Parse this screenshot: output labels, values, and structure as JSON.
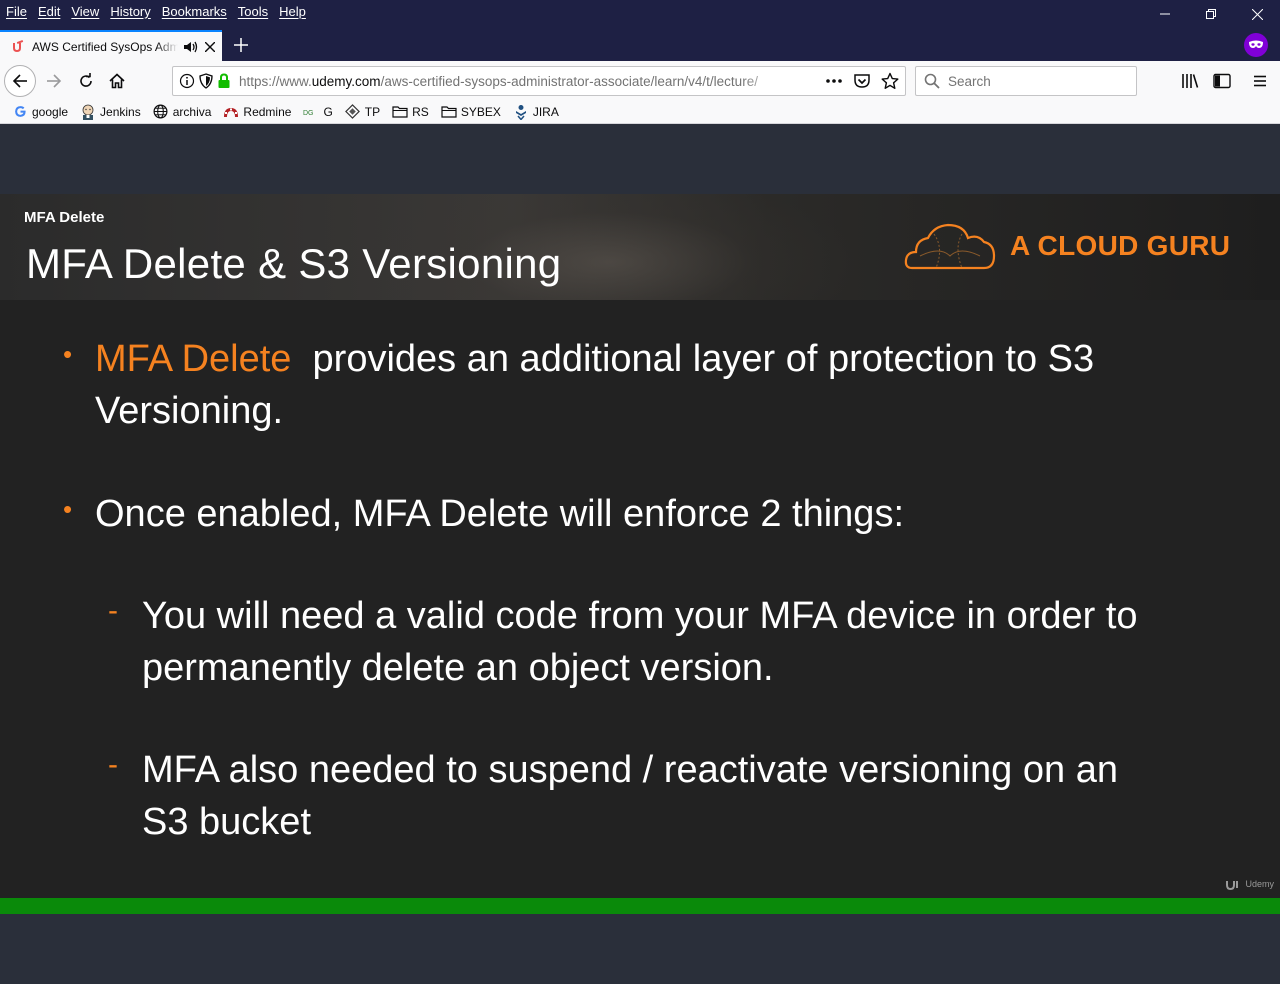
{
  "menubar": {
    "items": [
      "File",
      "Edit",
      "View",
      "History",
      "Bookmarks",
      "Tools",
      "Help"
    ]
  },
  "tab": {
    "title": "AWS Certified SysOps Administrator - Associate | Udemy",
    "favicon": "udemy-icon"
  },
  "navbar": {
    "url_prefix": "https://www.",
    "url_domain": "udemy.com",
    "url_path": "/aws-certified-sysops-administrator-associate/learn/v4/t/lecture/",
    "search_placeholder": "Search"
  },
  "bookmarks": [
    {
      "label": "google",
      "icon": "google-icon"
    },
    {
      "label": "Jenkins",
      "icon": "jenkins-icon"
    },
    {
      "label": "archiva",
      "icon": "globe-icon"
    },
    {
      "label": "Redmine",
      "icon": "redmine-icon"
    },
    {
      "label": "G",
      "icon": "g-icon"
    },
    {
      "label": "TP",
      "icon": "diamond-icon"
    },
    {
      "label": "RS",
      "icon": "folder-icon"
    },
    {
      "label": "SYBEX",
      "icon": "folder-icon"
    },
    {
      "label": "JIRA",
      "icon": "jira-icon"
    }
  ],
  "slide": {
    "section": "MFA Delete",
    "title": "MFA Delete & S3 Versioning",
    "brand": "A CLOUD GURU",
    "bullets": {
      "b1_highlight": "MFA Delete",
      "b1_rest": "provides an additional layer of protection to S3",
      "b1_line2": "Versioning.",
      "b2": "Once enabled, MFA Delete will enforce 2 things:",
      "s1_line1": "You will need a valid code from your MFA device in order to",
      "s1_line2": "permanently delete an object version.",
      "s2_line1": "MFA also needed to suspend / reactivate versioning on an",
      "s2_line2": "S3 bucket"
    },
    "watermark": "Udemy"
  },
  "video": {
    "progress_fraction": 1.0
  },
  "colors": {
    "accent_orange": "#f58220",
    "progress_green": "#0a8a0a",
    "titlebar": "#1e2044"
  }
}
